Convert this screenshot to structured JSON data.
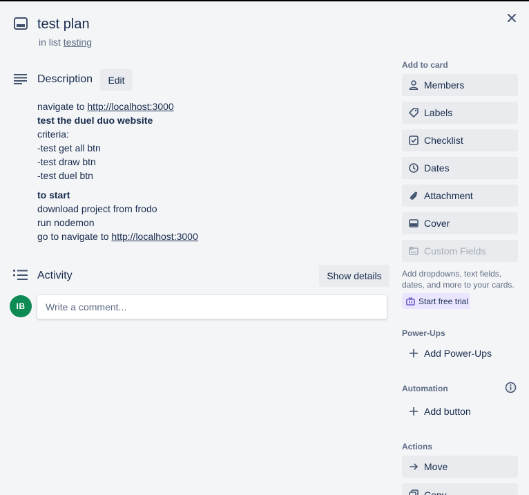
{
  "card": {
    "title": "test plan",
    "list_prefix": "in list",
    "list_name": "testing"
  },
  "description": {
    "heading": "Description",
    "edit_label": "Edit",
    "lines": {
      "l1_prefix": "navigate to",
      "l1_link": "http://localhost:3000",
      "l2": "test the duel duo website",
      "l3": "criteria:",
      "l4": "-test get all btn",
      "l5": "-test draw btn",
      "l6": "-test duel btn",
      "l7": "to start",
      "l8": "download project from frodo",
      "l9": "run nodemon",
      "l10_prefix": "go to navigate to",
      "l10_link": "http://localhost:3000"
    }
  },
  "activity": {
    "heading": "Activity",
    "show_details_label": "Show details",
    "avatar_initials": "IB",
    "avatar_color": "#0e8a55",
    "comment_placeholder": "Write a comment..."
  },
  "sidebar": {
    "add_to_card_label": "Add to card",
    "add_buttons": [
      {
        "label": "Members",
        "icon": "person-icon"
      },
      {
        "label": "Labels",
        "icon": "tag-icon"
      },
      {
        "label": "Checklist",
        "icon": "checkbox-icon"
      },
      {
        "label": "Dates",
        "icon": "clock-icon"
      },
      {
        "label": "Attachment",
        "icon": "paperclip-icon"
      },
      {
        "label": "Cover",
        "icon": "card-cover-icon"
      },
      {
        "label": "Custom Fields",
        "icon": "custom-fields-icon"
      }
    ],
    "custom_fields_hint": "Add dropdowns, text fields, dates, and more to your cards.",
    "trial_label": "Start free trial",
    "trial_color": "#eae6ff",
    "powerups_label": "Power-Ups",
    "add_powerups_label": "Add Power-Ups",
    "automation_label": "Automation",
    "add_button_label": "Add button",
    "actions_label": "Actions",
    "action_buttons": [
      {
        "label": "Move",
        "icon": "arrow-right-icon"
      },
      {
        "label": "Copy",
        "icon": "copy-icon"
      }
    ]
  }
}
